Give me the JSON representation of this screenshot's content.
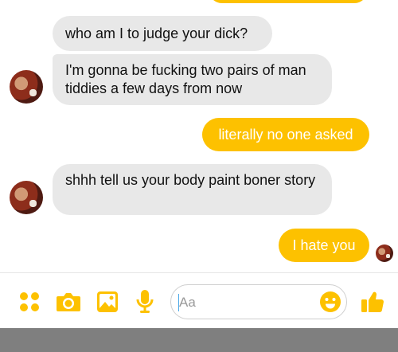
{
  "conversation": {
    "messages": [
      {
        "sender": "them",
        "text": "who am I to judge your dick?"
      },
      {
        "sender": "them",
        "text": "I'm gonna be fucking two pairs of man tiddies a few days from now"
      },
      {
        "sender": "me",
        "text": "literally no one asked"
      },
      {
        "sender": "them",
        "text": "shhh tell us your body paint boner story"
      },
      {
        "sender": "me",
        "text": "I hate you"
      }
    ]
  },
  "composer": {
    "placeholder": "Aa",
    "icons": [
      "more-apps-icon",
      "camera-icon",
      "gallery-icon",
      "microphone-icon",
      "emoji-icon",
      "thumbs-up-icon"
    ],
    "accent_color": "#fdc100"
  },
  "theme": {
    "incoming_bubble": "#e8e8e8",
    "outgoing_bubble": "#fdc100",
    "nav_bar": "#7f7f7f"
  }
}
